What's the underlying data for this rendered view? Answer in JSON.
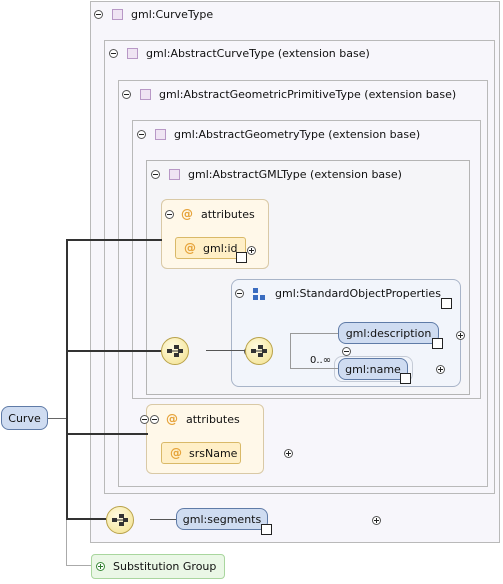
{
  "root": {
    "label": "Curve"
  },
  "types": {
    "curve": "gml:CurveType",
    "abstract_curve": "gml:AbstractCurveType (extension base)",
    "abstract_primitive": "gml:AbstractGeometricPrimitiveType (extension base)",
    "abstract_geometry": "gml:AbstractGeometryType (extension base)",
    "abstract_gml": "gml:AbstractGMLType (extension base)"
  },
  "attribute_groups": [
    {
      "title": "attributes",
      "attribute": "gml:id"
    },
    {
      "title": "attributes",
      "attribute": "srsName"
    }
  ],
  "standard_properties": {
    "title": "gml:StandardObjectProperties",
    "elements": [
      {
        "label": "gml:description"
      },
      {
        "label": "gml:name",
        "cardinality": "0..∞"
      }
    ]
  },
  "segments": {
    "label": "gml:segments"
  },
  "substitution": {
    "label": "Substitution Group"
  },
  "colors": {
    "element_fill": "#cfdcf1",
    "attribute_fill": "#fff8e9",
    "sequence_fill": "#f2e08c",
    "substitution_fill": "#eaf7e6"
  }
}
